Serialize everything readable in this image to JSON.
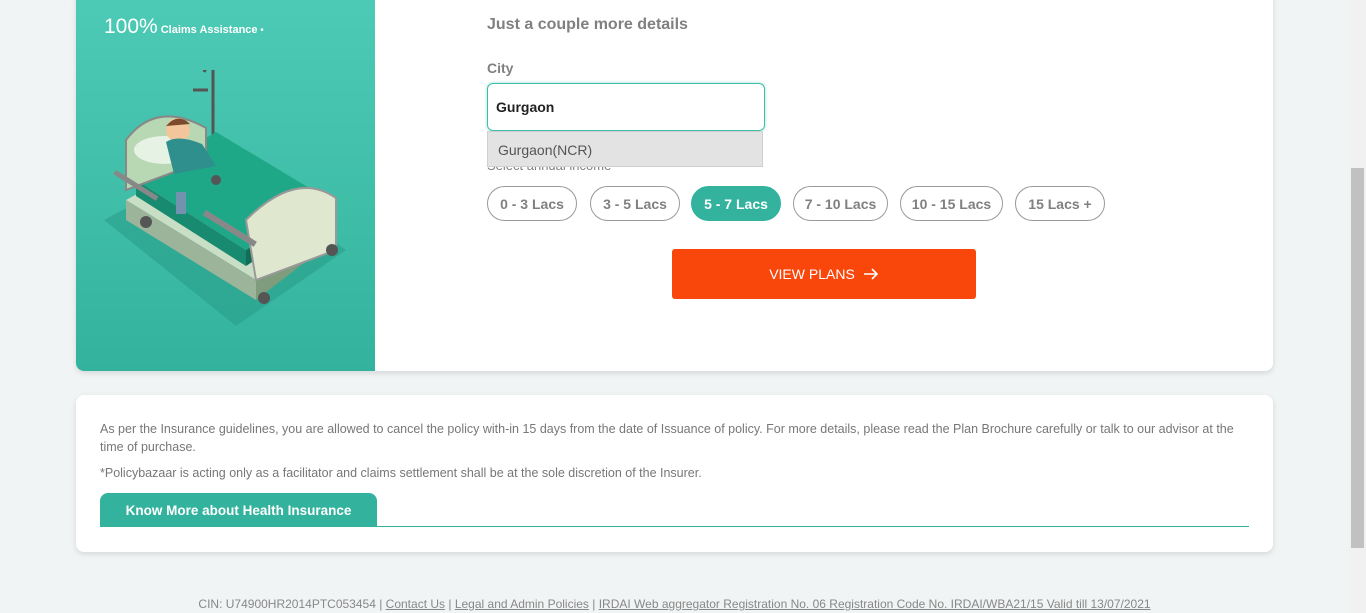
{
  "banner": {
    "claims_pct": "100%",
    "claims_text": "Claims Assistance"
  },
  "form": {
    "heading": "Just a couple more details",
    "city_label": "City",
    "city_value": "Gurgaon",
    "suggestion": "Gurgaon(NCR)",
    "income_label": "Select annual income",
    "income_options": [
      "0 - 3 Lacs",
      "3 - 5 Lacs",
      "5 - 7 Lacs",
      "7 - 10 Lacs",
      "10 - 15 Lacs",
      "15 Lacs +"
    ],
    "selected_income": "5 - 7 Lacs",
    "cta_label": "VIEW PLANS"
  },
  "info": {
    "text1": "As per the Insurance guidelines, you are allowed to cancel the policy with-in 15 days from the date of Issuance of policy. For more details, please read the Plan Brochure carefully or talk to our advisor at the time of purchase.",
    "text2": "*Policybazaar is acting only as a facilitator and claims settlement shall be at the sole discretion of the Insurer.",
    "tab_label": "Know More about Health Insurance"
  },
  "footer": {
    "cin": "CIN: U74900HR2014PTC053454",
    "contact": "Contact Us",
    "legal": "Legal and Admin Policies",
    "irdai": "IRDAI Web aggregator Registration No. 06 Registration Code No. IRDAI/WBA21/15 Valid till 13/07/2021",
    "sep": " | "
  },
  "colors": {
    "accent": "#33b39d",
    "cta": "#f9460a"
  },
  "icons": {
    "cta": "arrow-right-icon",
    "illustration": "hospital-bed-illustration"
  }
}
